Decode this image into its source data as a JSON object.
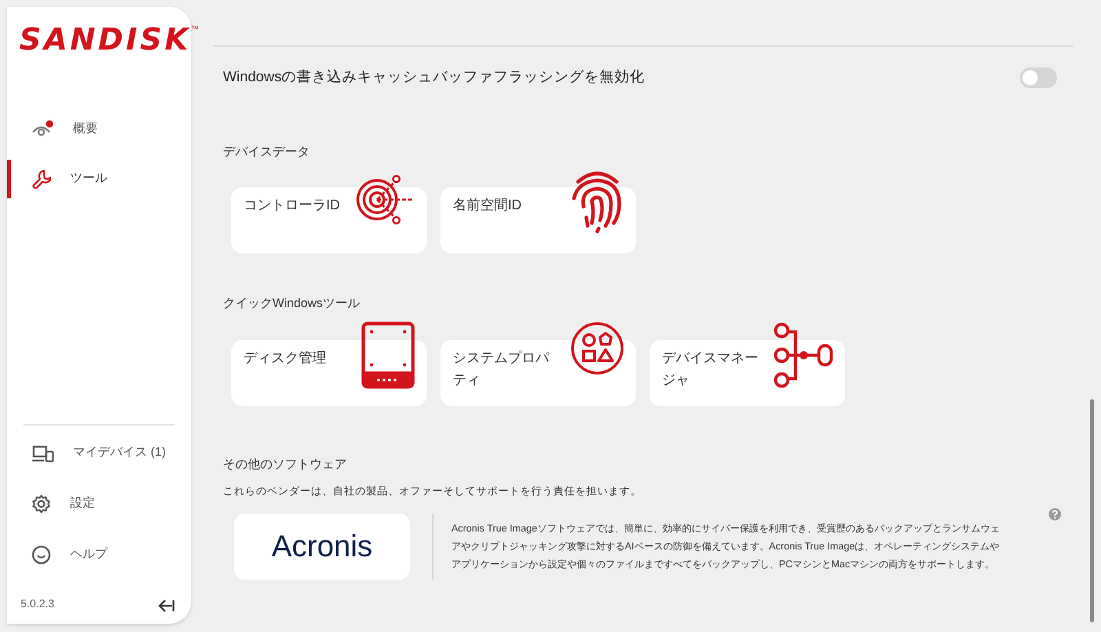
{
  "sidebar": {
    "logo": "SANDISK",
    "trademark": "™",
    "nav_items": [
      {
        "label": "概要",
        "kind": "eye",
        "selected": false
      },
      {
        "label": "ツール",
        "kind": "wrench",
        "selected": true
      }
    ],
    "bottom_items": [
      {
        "label": "マイデバイス (1)",
        "kind": "devices"
      },
      {
        "label": "設定",
        "kind": "gear"
      },
      {
        "label": "ヘルプ",
        "kind": "smile"
      }
    ],
    "version": "5.0.2.3"
  },
  "settings": [
    {
      "label": "Windowsの書き込みキャッシュバッファフラッシングを無効化",
      "on": false
    }
  ],
  "sections": [
    {
      "title": "デバイスデータ",
      "cards": [
        {
          "label": "コントローラID",
          "kind": "target"
        },
        {
          "label": "名前空間ID",
          "kind": "fingerprint"
        }
      ]
    },
    {
      "title": "クイックWindowsツール",
      "cards": [
        {
          "label": "ディスク管理",
          "kind": "drive"
        },
        {
          "label": "システムプロパティ",
          "kind": "shapes"
        },
        {
          "label": "デバイスマネージャ",
          "kind": "tree"
        }
      ]
    }
  ],
  "other_software": {
    "title": "その他のソフトウェア",
    "disclaimer": "これらのベンダーは、自社の製品、オファーそしてサポートを行う責任を担います。",
    "vendors": [
      {
        "logo": "Acronis",
        "description": "Acronis True Imageソフトウェアでは、簡単に、効率的にサイバー保護を利用でき、受賞歴のあるバックアップとランサムウェアやクリプトジャッキング攻撃に対するAIベースの防御を備えています。Acronis True Imageは、オペレーティングシステムやアプリケーションから設定や個々のファイルまですべてをバックアップし、PCマシンとMacマシンの両方をサポートします。"
      }
    ]
  }
}
